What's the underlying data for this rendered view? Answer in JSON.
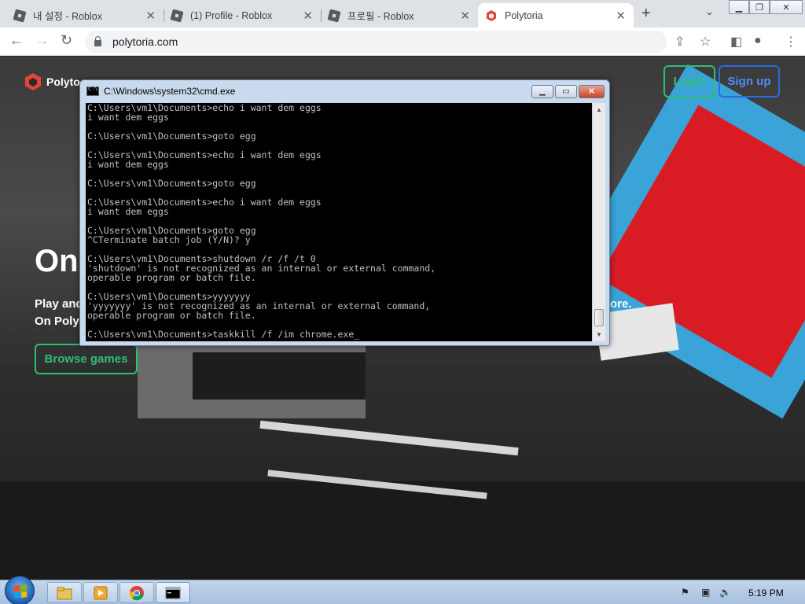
{
  "browser": {
    "tabs": [
      {
        "title": "내 설정 - Roblox",
        "favicon": "roblox-icon",
        "active": false
      },
      {
        "title": "(1) Profile - Roblox",
        "favicon": "roblox-icon",
        "active": false
      },
      {
        "title": "프로필 - Roblox",
        "favicon": "roblox-icon",
        "active": false
      },
      {
        "title": "Polytoria",
        "favicon": "polytoria-icon",
        "active": true
      }
    ],
    "new_tab": "+",
    "url": "polytoria.com"
  },
  "page": {
    "logo_text": "Polyto",
    "login_label": "Login",
    "signup_label": "Sign up",
    "hero_title": "On",
    "hero_line1": "Play and",
    "hero_line1_end": "ore.",
    "hero_line2": "On Polyt",
    "browse_label": "Browse games"
  },
  "cmd": {
    "title": "C:\\Windows\\system32\\cmd.exe",
    "output": "C:\\Users\\vm1\\Documents>echo i want dem eggs\ni want dem eggs\n\nC:\\Users\\vm1\\Documents>goto egg\n\nC:\\Users\\vm1\\Documents>echo i want dem eggs\ni want dem eggs\n\nC:\\Users\\vm1\\Documents>goto egg\n\nC:\\Users\\vm1\\Documents>echo i want dem eggs\ni want dem eggs\n\nC:\\Users\\vm1\\Documents>goto egg\n^CTerminate batch job (Y/N)? y\n\nC:\\Users\\vm1\\Documents>shutdown /r /f /t 0\n'shutdown' is not recognized as an internal or external command,\noperable program or batch file.\n\nC:\\Users\\vm1\\Documents>yyyyyyy\n'yyyyyyy' is not recognized as an internal or external command,\noperable program or batch file.\n\nC:\\Users\\vm1\\Documents>taskkill /f /im chrome.exe_"
  },
  "taskbar": {
    "clock": "5:19 PM",
    "apps": [
      "explorer-icon",
      "media-player-icon",
      "chrome-icon",
      "cmd-icon"
    ]
  },
  "colors": {
    "accent_green": "#2fbf71",
    "accent_blue": "#2d6be0",
    "polytoria_red": "#e0453a"
  }
}
